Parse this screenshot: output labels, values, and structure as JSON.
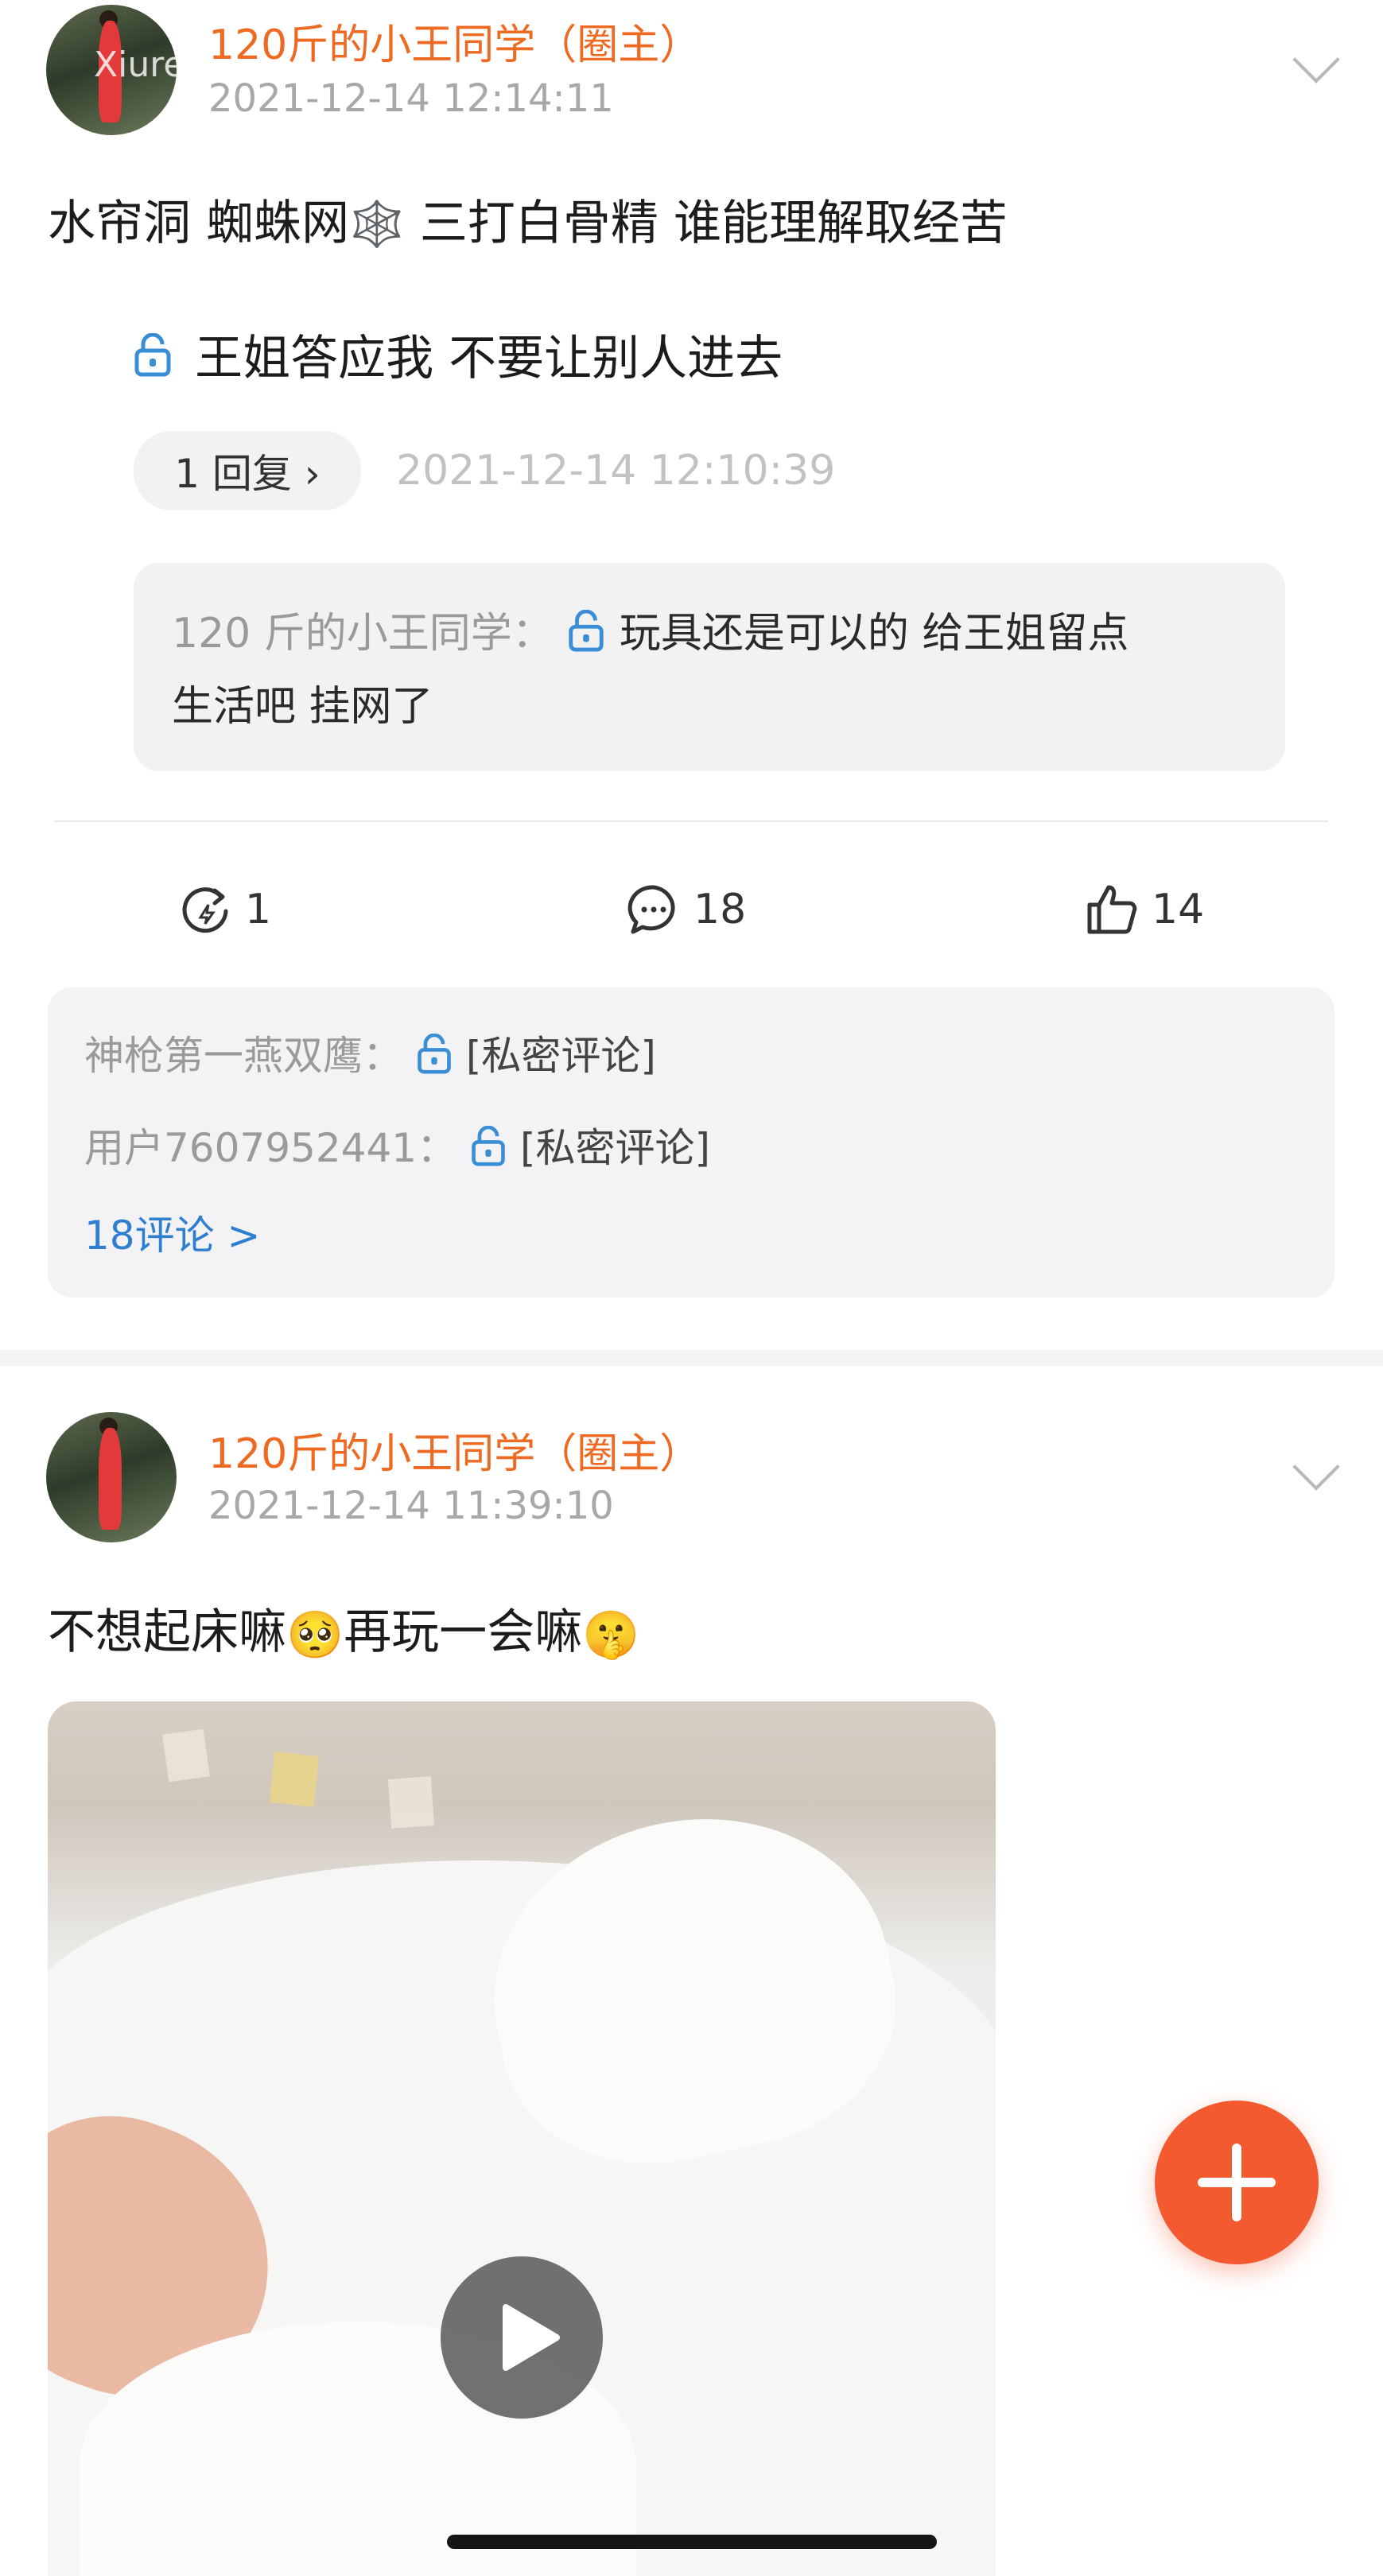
{
  "post1": {
    "author": "120斤的小王同学（圈主）",
    "timestamp": "2021-12-14 12:14:11",
    "watermark": "Xiuren.cc",
    "body_text": "水帘洞 蜘蛛网",
    "body_text_emoji": "🕸️",
    "body_text_rest": " 三打白骨精 谁能理解取经苦",
    "locked_line": "王姐答应我  不要让别人进去",
    "reply_pill": "1 回复 ›",
    "reply_time": "2021-12-14 12:10:39",
    "quote_author": "120 斤的小王同学：",
    "quote_text_1": "玩具还是可以的 给王姐留点",
    "quote_text_2": "生活吧 挂网了",
    "actions": {
      "repost_count": "1",
      "comment_count": "18",
      "like_count": "14"
    },
    "comments": [
      {
        "user": "神枪第一燕双鹰：",
        "text": "[私密评论]"
      },
      {
        "user": "用户7607952441：",
        "text": "[私密评论]"
      }
    ],
    "comments_link": "18评论 >"
  },
  "post2": {
    "author": "120斤的小王同学（圈主）",
    "timestamp": "2021-12-14 11:39:10",
    "body_text_1": "不想起床嘛",
    "emoji_1": "🥺",
    "body_text_2": "再玩一会嘛",
    "emoji_2": "🤫"
  },
  "fab": {
    "icon": "plus-icon"
  },
  "colors": {
    "accent_orange": "#ee6a22",
    "fab": "#f35a30",
    "link_blue": "#2f7fd0",
    "lock_blue": "#3a8ed6"
  }
}
